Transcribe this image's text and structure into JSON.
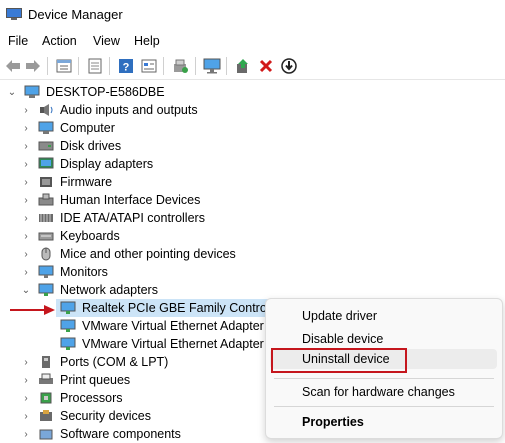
{
  "window": {
    "title": "Device Manager"
  },
  "menu": [
    "File",
    "Action",
    "View",
    "Help"
  ],
  "toolbar": [
    "back-icon",
    "forward-icon",
    "properties-icon",
    "show-hidden-icon",
    "help-icon",
    "details-icon",
    "scan-icon",
    "monitor-icon",
    "update-driver-icon",
    "uninstall-icon",
    "download-icon"
  ],
  "tree": {
    "root": "DESKTOP-E586DBE",
    "categories": [
      "Audio inputs and outputs",
      "Computer",
      "Disk drives",
      "Display adapters",
      "Firmware",
      "Human Interface Devices",
      "IDE ATA/ATAPI controllers",
      "Keyboards",
      "Mice and other pointing devices",
      "Monitors",
      "Network adapters"
    ],
    "network_children": [
      "Realtek PCIe GBE Family Controller",
      "VMware Virtual Ethernet Adapter fo",
      "VMware Virtual Ethernet Adapter fo"
    ],
    "more_categories": [
      "Ports (COM & LPT)",
      "Print queues",
      "Processors",
      "Security devices",
      "Software components"
    ]
  },
  "context_menu": {
    "update": "Update driver",
    "disable": "Disable device",
    "uninstall": "Uninstall device",
    "scan": "Scan for hardware changes",
    "properties": "Properties"
  },
  "colors": {
    "accent_red": "#c5161d",
    "selection": "#cce4f7"
  }
}
